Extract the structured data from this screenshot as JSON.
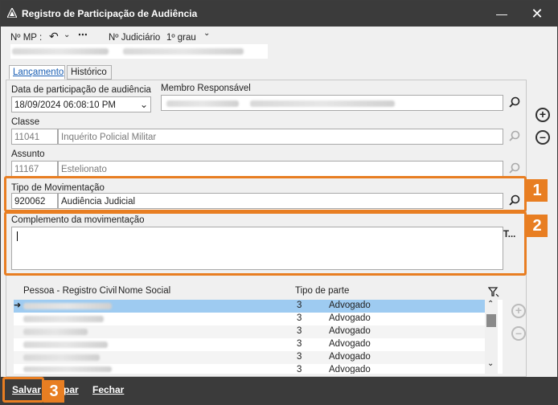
{
  "window": {
    "title": "Registro de Participação de Audiência"
  },
  "header": {
    "mp_label": "Nº MP :",
    "judiciario_label": "Nº Judiciário",
    "grau_label": "1º grau"
  },
  "tabs": [
    {
      "label": "Lançamento"
    },
    {
      "label": "Histórico"
    }
  ],
  "form": {
    "data_label": "Data de participação de audiência",
    "data_value": "18/09/2024 06:08:10 PM",
    "membro_label": "Membro Responsável",
    "classe_label": "Classe",
    "classe_code": "11041",
    "classe_desc": "Inquérito Policial Militar",
    "assunto_label": "Assunto",
    "assunto_code": "11167",
    "assunto_desc": "Estelionato",
    "tipo_label": "Tipo de Movimentação",
    "tipo_code": "920062",
    "tipo_desc": "Audiência Judicial",
    "complemento_label": "Complemento da movimentação",
    "complemento_btn": "T..."
  },
  "grid": {
    "columns": [
      "Pessoa - Registro Civil",
      "Nome Social",
      "Tipo de parte"
    ],
    "rows": [
      {
        "tipo": "3",
        "parte": "Advogado"
      },
      {
        "tipo": "3",
        "parte": "Advogado"
      },
      {
        "tipo": "3",
        "parte": "Advogado"
      },
      {
        "tipo": "3",
        "parte": "Advogado"
      },
      {
        "tipo": "3",
        "parte": "Advogado"
      },
      {
        "tipo": "3",
        "parte": "Advogado"
      }
    ]
  },
  "badges": [
    "1",
    "2",
    "3"
  ],
  "footer": {
    "salvar": "Salvar",
    "limpar_partial": "par",
    "fechar": "Fechar"
  },
  "colors": {
    "accent": "#e87e22",
    "titlebar": "#3b3b3b",
    "selection": "#9ecbf1"
  }
}
